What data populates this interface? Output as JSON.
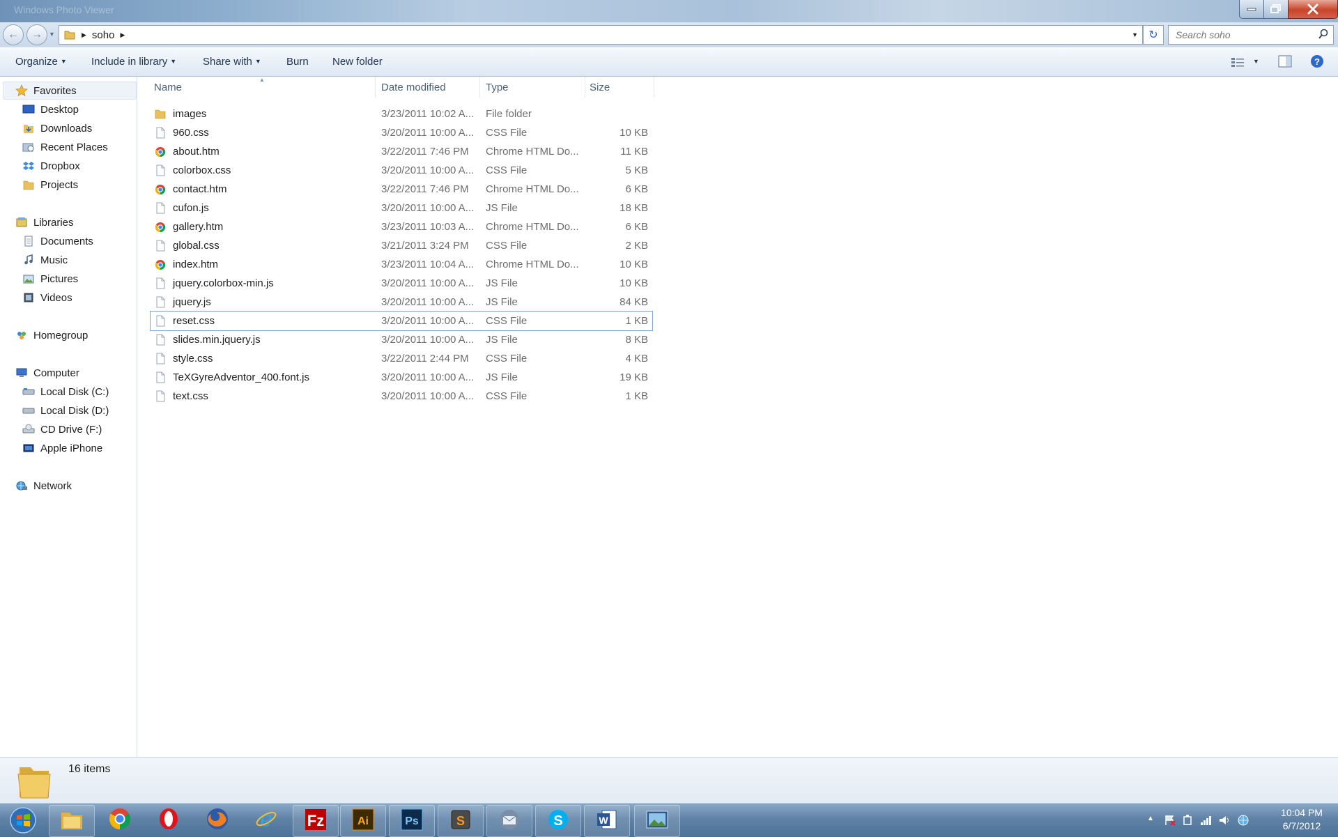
{
  "window": {
    "title_ghost": "Windows Photo Viewer"
  },
  "address": {
    "folder": "soho",
    "search_placeholder": "Search soho"
  },
  "toolbar": {
    "organize": "Organize",
    "include_in_library": "Include in library",
    "share_with": "Share with",
    "burn": "Burn",
    "new_folder": "New folder"
  },
  "nav": {
    "favorites": {
      "label": "Favorites",
      "items": [
        "Desktop",
        "Downloads",
        "Recent Places",
        "Dropbox",
        "Projects"
      ]
    },
    "libraries": {
      "label": "Libraries",
      "items": [
        "Documents",
        "Music",
        "Pictures",
        "Videos"
      ]
    },
    "homegroup": "Homegroup",
    "computer": {
      "label": "Computer",
      "items": [
        "Local Disk (C:)",
        "Local Disk (D:)",
        "CD Drive (F:)",
        "Apple iPhone"
      ]
    },
    "network": "Network"
  },
  "columns": {
    "name": "Name",
    "date": "Date modified",
    "type": "Type",
    "size": "Size"
  },
  "files": [
    {
      "name": "images",
      "date": "3/23/2011 10:02 A...",
      "type": "File folder",
      "size": "",
      "icon": "folder-icon"
    },
    {
      "name": "960.css",
      "date": "3/20/2011 10:00 A...",
      "type": "CSS File",
      "size": "10 KB",
      "icon": "file-icon"
    },
    {
      "name": "about.htm",
      "date": "3/22/2011 7:46 PM",
      "type": "Chrome HTML Do...",
      "size": "11 KB",
      "icon": "chrome-icon"
    },
    {
      "name": "colorbox.css",
      "date": "3/20/2011 10:00 A...",
      "type": "CSS File",
      "size": "5 KB",
      "icon": "file-icon"
    },
    {
      "name": "contact.htm",
      "date": "3/22/2011 7:46 PM",
      "type": "Chrome HTML Do...",
      "size": "6 KB",
      "icon": "chrome-icon"
    },
    {
      "name": "cufon.js",
      "date": "3/20/2011 10:00 A...",
      "type": "JS File",
      "size": "18 KB",
      "icon": "file-icon"
    },
    {
      "name": "gallery.htm",
      "date": "3/23/2011 10:03 A...",
      "type": "Chrome HTML Do...",
      "size": "6 KB",
      "icon": "chrome-icon"
    },
    {
      "name": "global.css",
      "date": "3/21/2011 3:24 PM",
      "type": "CSS File",
      "size": "2 KB",
      "icon": "file-icon"
    },
    {
      "name": "index.htm",
      "date": "3/23/2011 10:04 A...",
      "type": "Chrome HTML Do...",
      "size": "10 KB",
      "icon": "chrome-icon"
    },
    {
      "name": "jquery.colorbox-min.js",
      "date": "3/20/2011 10:00 A...",
      "type": "JS File",
      "size": "10 KB",
      "icon": "file-icon"
    },
    {
      "name": "jquery.js",
      "date": "3/20/2011 10:00 A...",
      "type": "JS File",
      "size": "84 KB",
      "icon": "file-icon"
    },
    {
      "name": "reset.css",
      "date": "3/20/2011 10:00 A...",
      "type": "CSS File",
      "size": "1 KB",
      "icon": "file-icon",
      "selected": true
    },
    {
      "name": "slides.min.jquery.js",
      "date": "3/20/2011 10:00 A...",
      "type": "JS File",
      "size": "8 KB",
      "icon": "file-icon"
    },
    {
      "name": "style.css",
      "date": "3/22/2011 2:44 PM",
      "type": "CSS File",
      "size": "4 KB",
      "icon": "file-icon"
    },
    {
      "name": "TeXGyreAdventor_400.font.js",
      "date": "3/20/2011 10:00 A...",
      "type": "JS File",
      "size": "19 KB",
      "icon": "file-icon"
    },
    {
      "name": "text.css",
      "date": "3/20/2011 10:00 A...",
      "type": "CSS File",
      "size": "1 KB",
      "icon": "file-icon"
    }
  ],
  "status": {
    "item_count": "16 items"
  },
  "taskbar": {
    "apps": [
      "explorer-icon",
      "chrome-icon",
      "opera-icon",
      "firefox-icon",
      "ie-icon",
      "filezilla-icon",
      "illustrator-icon",
      "photoshop-icon",
      "sublime-icon",
      "thunderbird-icon",
      "skype-icon",
      "word-icon",
      "photo-viewer-icon"
    ],
    "time": "10:04 PM",
    "date": "6/7/2012"
  },
  "colors": {
    "accent": "#2d6ac7",
    "selection_border": "#7da2ce",
    "secondary_text": "#6d6d6d"
  }
}
